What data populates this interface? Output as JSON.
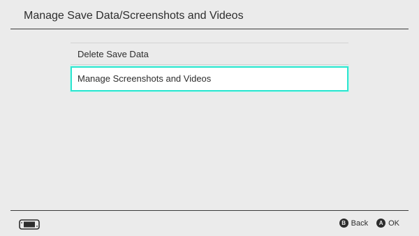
{
  "header": {
    "title": "Manage Save Data/Screenshots and Videos"
  },
  "menu": {
    "items": [
      {
        "label": "Delete Save Data",
        "selected": false
      },
      {
        "label": "Manage Screenshots and Videos",
        "selected": true
      }
    ]
  },
  "footer": {
    "console_icon": "handheld-console-icon",
    "back": {
      "glyph": "B",
      "label": "Back"
    },
    "ok": {
      "glyph": "A",
      "label": "OK"
    }
  },
  "colors": {
    "background": "#ebebeb",
    "text": "#2d2d2d",
    "selection_border": "#2ee6d0"
  }
}
